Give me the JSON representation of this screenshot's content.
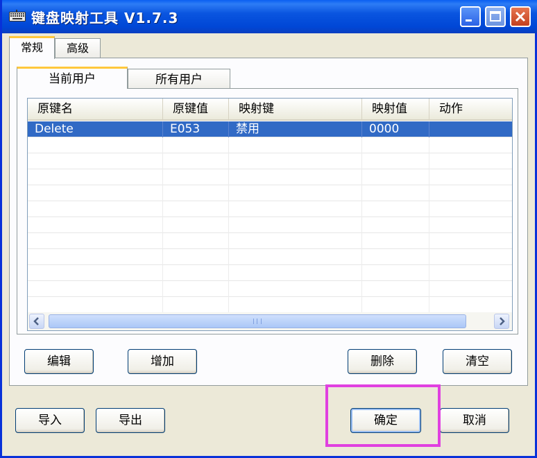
{
  "window": {
    "title": "键盘映射工具 V1.7.3",
    "controls": {
      "minimize_icon": "minimize-icon",
      "maximize_icon": "maximize-icon",
      "close_icon": "close-icon"
    }
  },
  "outer_tabs": [
    {
      "label": "常规",
      "active": true
    },
    {
      "label": "高级",
      "active": false
    }
  ],
  "inner_tabs": [
    {
      "label": "当前用户",
      "active": true
    },
    {
      "label": "所有用户",
      "active": false
    }
  ],
  "list": {
    "columns": [
      "原键名",
      "原键值",
      "映射键",
      "映射值",
      "动作"
    ],
    "rows": [
      {
        "cells": [
          "Delete",
          "E053",
          "禁用",
          "0000",
          ""
        ],
        "selected": true
      }
    ],
    "scrollbar_grip": "III"
  },
  "buttons": {
    "edit": "编辑",
    "add": "增加",
    "delete": "删除",
    "clear": "清空",
    "import": "导入",
    "export": "导出",
    "ok": "确定",
    "cancel": "取消"
  },
  "colors": {
    "titlebar": "#0a55e0",
    "selection": "#316ac5",
    "highlight_box": "#e040e0",
    "tab_accent": "#ffc83c"
  }
}
